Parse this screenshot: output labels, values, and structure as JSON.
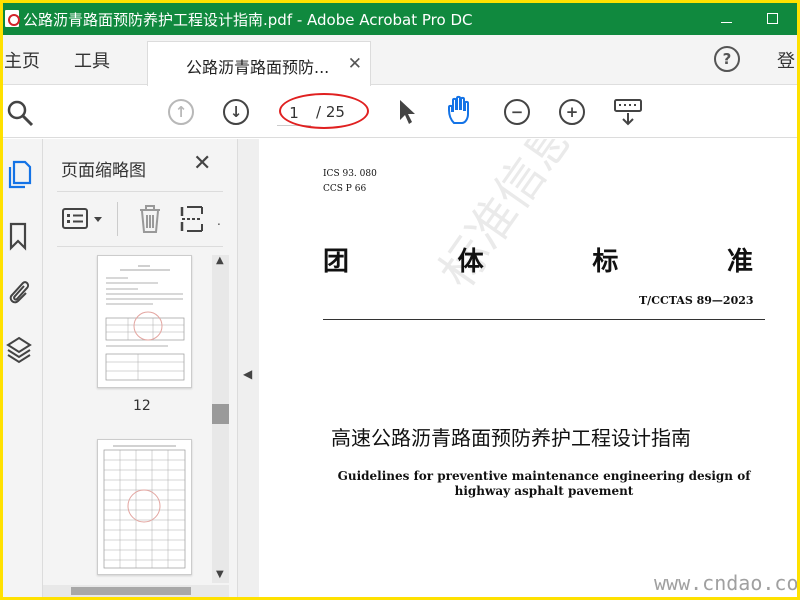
{
  "window": {
    "title": "公路沥青路面预防养护工程设计指南.pdf - Adobe Acrobat Pro DC"
  },
  "tabs": {
    "home": "主页",
    "tools": "工具",
    "document": "公路沥青路面预防...",
    "help": "?",
    "login": "登"
  },
  "toolbar": {
    "current_page": "1",
    "total_pages": "/ 25"
  },
  "thumbnails": {
    "panel_title": "页面缩略图",
    "page_labels": [
      "12"
    ]
  },
  "document": {
    "ics": "ICS  93. 080",
    "ccs": "CCS  P  66",
    "standard_chars": [
      "团",
      "体",
      "标",
      "准"
    ],
    "standard_code": "T/CCTAS  89—2023",
    "title_cn": "高速公路沥青路面预防养护工程设计指南",
    "title_en": "Guidelines for preventive maintenance engineering design of highway asphalt pavement",
    "watermark": "标准信息平台",
    "site_mark": "www.cndao.com"
  },
  "colors": {
    "titlebar": "#10893e",
    "highlight_border": "#ffe100",
    "annotation": "#e02020",
    "hand_tool": "#1473e6"
  }
}
